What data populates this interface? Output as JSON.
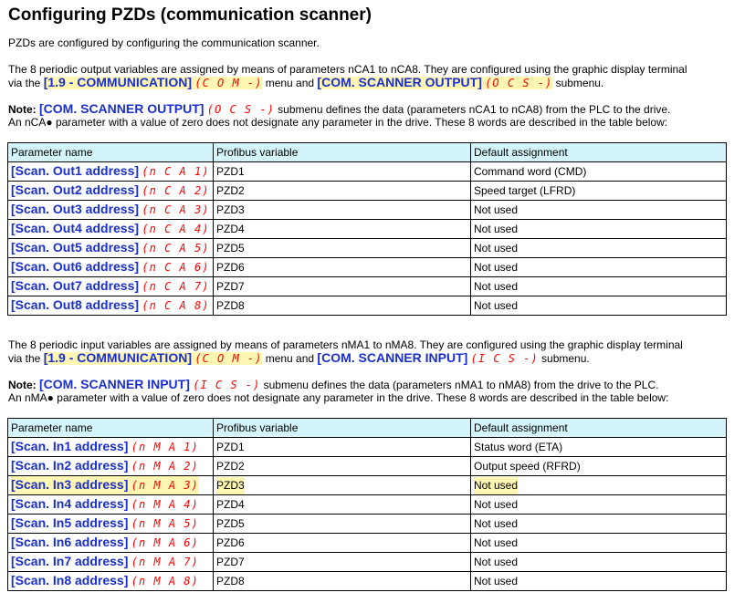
{
  "title": "Configuring PZDs (communication scanner)",
  "intro": "PZDs are configured by configuring the communication scanner.",
  "output_section": {
    "line1": "The 8 periodic output variables are assigned by means of parameters nCA1 to nCA8. They are configured using the graphic display terminal",
    "line2_prefix": "via the ",
    "menu_label": "[1.9 - COMMUNICATION]",
    "menu_code": "(C O M -)",
    "mid": " menu and ",
    "submenu_label": "[COM. SCANNER OUTPUT]",
    "submenu_code": "(O C S -)",
    "suffix": " submenu.",
    "note_prefix": "Note: ",
    "note_label": "[COM. SCANNER OUTPUT]",
    "note_code": "(O C S -)",
    "note_text": " submenu defines the data (parameters nCA1 to nCA8) from the PLC to the drive.",
    "note_line2": "An nCA● parameter with a value of zero does not designate any parameter in the drive. These 8 words are described in the table below:"
  },
  "input_section": {
    "line1": "The 8 periodic input variables are assigned by means of parameters nMA1 to nMA8. They are configured using the graphic display terminal",
    "line2_prefix": "via the ",
    "menu_label": "[1.9 - COMMUNICATION]",
    "menu_code": "(C O M -)",
    "mid": " menu and ",
    "submenu_label": "[COM. SCANNER INPUT]",
    "submenu_code": "(I C S -)",
    "suffix": " submenu.",
    "note_prefix": "Note: ",
    "note_label": "[COM. SCANNER INPUT]",
    "note_code": "(I C S -)",
    "note_text": " submenu defines the data (parameters nMA1 to nMA8) from the drive to the PLC.",
    "note_line2": "An nMA● parameter with a value of zero does not designate any parameter in the drive. These 8 words are described in the table below:"
  },
  "table_headers": [
    "Parameter name",
    "Profibus variable",
    "Default assignment"
  ],
  "output_table": [
    {
      "name": "[Scan. Out1 address]",
      "code": "(n C A 1)",
      "var": "PZD1",
      "default": "Command word (CMD)"
    },
    {
      "name": "[Scan. Out2 address]",
      "code": "(n C A 2)",
      "var": "PZD2",
      "default": "Speed target (LFRD)"
    },
    {
      "name": "[Scan. Out3 address]",
      "code": "(n C A 3)",
      "var": "PZD3",
      "default": "Not used"
    },
    {
      "name": "[Scan. Out4 address]",
      "code": "(n C A 4)",
      "var": "PZD4",
      "default": "Not used"
    },
    {
      "name": "[Scan. Out5 address]",
      "code": "(n C A 5)",
      "var": "PZD5",
      "default": "Not used"
    },
    {
      "name": "[Scan. Out6 address]",
      "code": "(n C A 6)",
      "var": "PZD6",
      "default": "Not used"
    },
    {
      "name": "[Scan. Out7 address]",
      "code": "(n C A 7)",
      "var": "PZD7",
      "default": "Not used"
    },
    {
      "name": "[Scan. Out8 address]",
      "code": "(n C A 8)",
      "var": "PZD8",
      "default": "Not used"
    }
  ],
  "input_table": [
    {
      "name": "[Scan. In1 address]",
      "code": "(n M A 1)",
      "var": "PZD1",
      "default": "Status word (ETA)"
    },
    {
      "name": "[Scan. In2 address]",
      "code": "(n M A 2)",
      "var": "PZD2",
      "default": "Output speed (RFRD)"
    },
    {
      "name": "[Scan. In3 address]",
      "code": "(n M A 3)",
      "var": "PZD3",
      "default": "Not used",
      "highlighted": true
    },
    {
      "name": "[Scan. In4 address]",
      "code": "(n M A 4)",
      "var": "PZD4",
      "default": "Not used"
    },
    {
      "name": "[Scan. In5 address]",
      "code": "(n M A 5)",
      "var": "PZD5",
      "default": "Not used"
    },
    {
      "name": "[Scan. In6 address]",
      "code": "(n M A 6)",
      "var": "PZD6",
      "default": "Not used"
    },
    {
      "name": "[Scan. In7 address]",
      "code": "(n M A 7)",
      "var": "PZD7",
      "default": "Not used"
    },
    {
      "name": "[Scan. In8 address]",
      "code": "(n M A 8)",
      "var": "PZD8",
      "default": "Not used"
    }
  ],
  "colors": {
    "header_bg": "#d4f4fb",
    "highlight": "#fff6b3",
    "param_blue": "#1a2fcf",
    "code_red": "#ff0000"
  }
}
